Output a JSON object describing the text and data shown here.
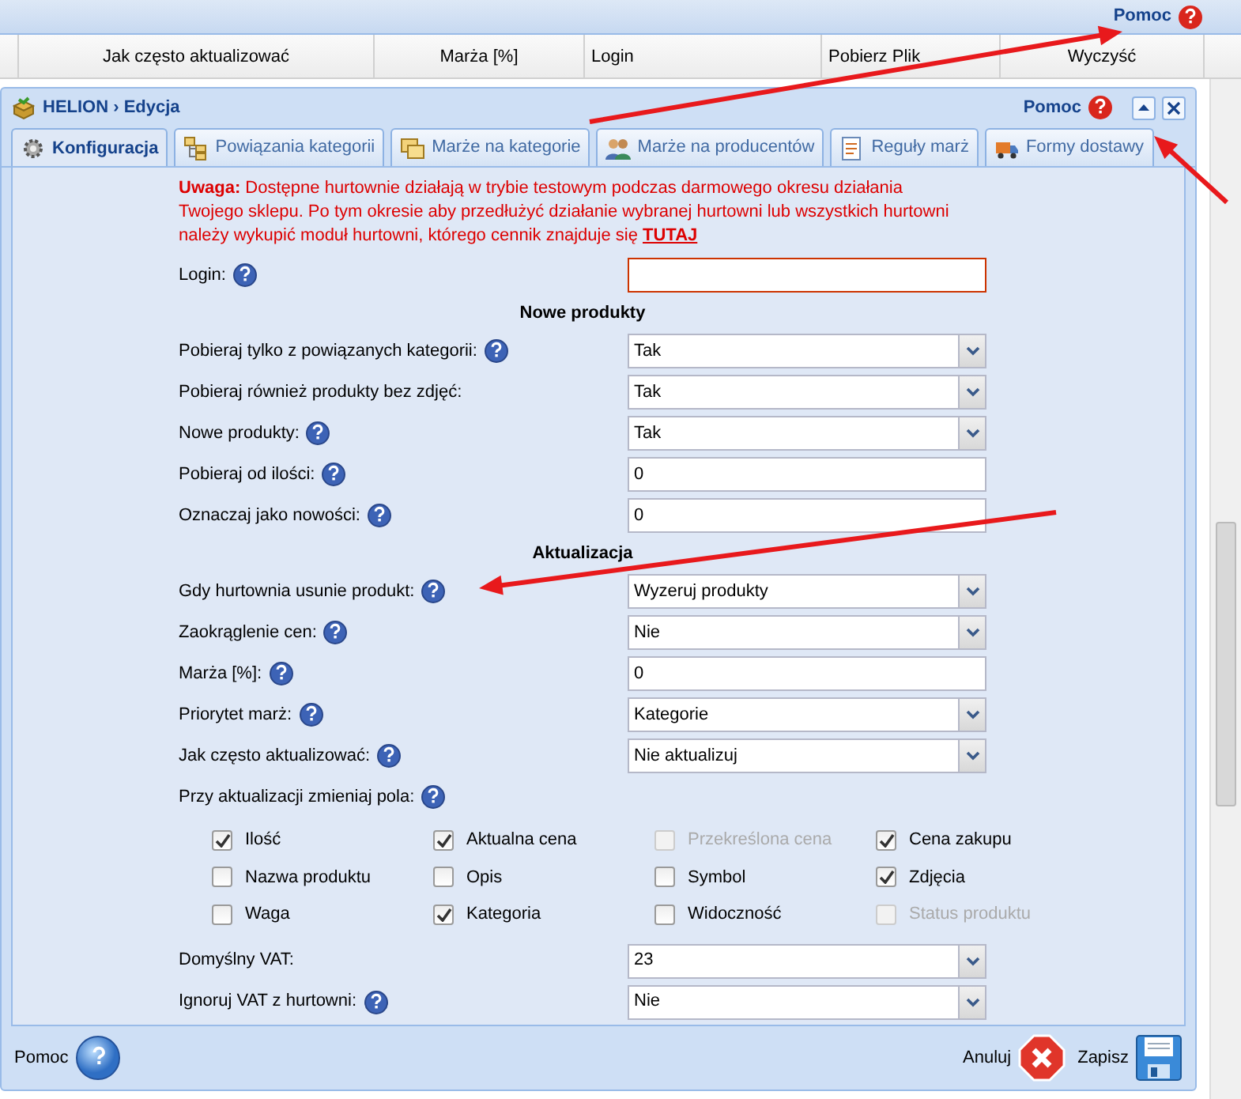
{
  "top_bar": {
    "help_link": "Pomoc"
  },
  "grid_columns": [
    "Jak często aktualizować",
    "Marża [%]",
    "Login",
    "Pobierz Plik",
    "Wyczyść"
  ],
  "dialog": {
    "title": "HELION › Edycja",
    "help_link": "Pomoc",
    "tabs": [
      {
        "label": "Konfiguracja",
        "selected": true
      },
      {
        "label": "Powiązania kategorii",
        "selected": false
      },
      {
        "label": "Marże na kategorie",
        "selected": false
      },
      {
        "label": "Marże na producentów",
        "selected": false
      },
      {
        "label": "Reguły marż",
        "selected": false
      },
      {
        "label": "Formy dostawy",
        "selected": false
      }
    ],
    "notice": {
      "text": "**Uwaga:** Dostępne hurtownie działają w trybie testowym podczas darmowego okresu działania Twojego sklepu. Po tym okresie aby przedłużyć działanie wybranej hurtowni lub wszystkich hurtowni należy wykupić moduł hurtowni, którego cennik znajduje się",
      "link": "TUTAJ"
    },
    "fields": [
      {
        "kind": "text",
        "label": "Login:",
        "help": true,
        "invalid": true
      },
      {
        "kind": "heading",
        "label": "Nowe produkty"
      },
      {
        "kind": "select",
        "label": "Pobieraj tylko z powiązanych kategorii:",
        "help": true,
        "value": "Tak"
      },
      {
        "kind": "select",
        "label": "Pobieraj również produkty bez zdjęć:",
        "help": false,
        "value": "Tak"
      },
      {
        "kind": "select",
        "label": "Nowe produkty:",
        "help": true,
        "value": "Tak"
      },
      {
        "kind": "text",
        "label": "Pobieraj od ilości:",
        "help": true,
        "value": "0",
        "invalid": false
      },
      {
        "kind": "text",
        "label": "Oznaczaj jako nowości:",
        "help": true,
        "value": "0",
        "invalid": false
      },
      {
        "kind": "heading",
        "label": "Aktualizacja"
      },
      {
        "kind": "select",
        "label": "Gdy hurtownia usunie produkt:",
        "help": true,
        "value": "Wyzeruj produkty"
      },
      {
        "kind": "select",
        "label": "Zaokrąglenie cen:",
        "help": true,
        "value": "Nie"
      },
      {
        "kind": "text",
        "label": "Marża [%]:",
        "help": true,
        "value": "0",
        "invalid": false
      },
      {
        "kind": "select",
        "label": "Priorytet marż:",
        "help": true,
        "value": "Kategorie"
      },
      {
        "kind": "select",
        "label": "Jak często aktualizować:",
        "help": true,
        "value": "Nie aktualizuj"
      },
      {
        "kind": "checks",
        "label": "Przy aktualizacji zmieniaj pola:",
        "help": true,
        "items": [
          {
            "label": "Ilość",
            "checked": true,
            "disabled": false
          },
          {
            "label": "Aktualna cena",
            "checked": true,
            "disabled": false
          },
          {
            "label": "Przekreślona cena",
            "checked": false,
            "disabled": true
          },
          {
            "label": "Cena zakupu",
            "checked": true,
            "disabled": false
          },
          {
            "label": "Nazwa produktu",
            "checked": false,
            "disabled": false
          },
          {
            "label": "Opis",
            "checked": false,
            "disabled": false
          },
          {
            "label": "Symbol",
            "checked": false,
            "disabled": false
          },
          {
            "label": "Zdjęcia",
            "checked": true,
            "disabled": false
          },
          {
            "label": "Waga",
            "checked": false,
            "disabled": false
          },
          {
            "label": "Kategoria",
            "checked": true,
            "disabled": false
          },
          {
            "label": "Widoczność",
            "checked": false,
            "disabled": false
          },
          {
            "label": "Status produktu",
            "checked": false,
            "disabled": true
          }
        ]
      },
      {
        "kind": "select",
        "label": "Domyślny VAT:",
        "help": false,
        "value": "23"
      },
      {
        "kind": "select",
        "label": "Ignoruj VAT z hurtowni:",
        "help": true,
        "value": "Nie"
      }
    ],
    "footer": {
      "help": "Pomoc",
      "cancel": "Anuluj",
      "save": "Zapisz"
    }
  }
}
